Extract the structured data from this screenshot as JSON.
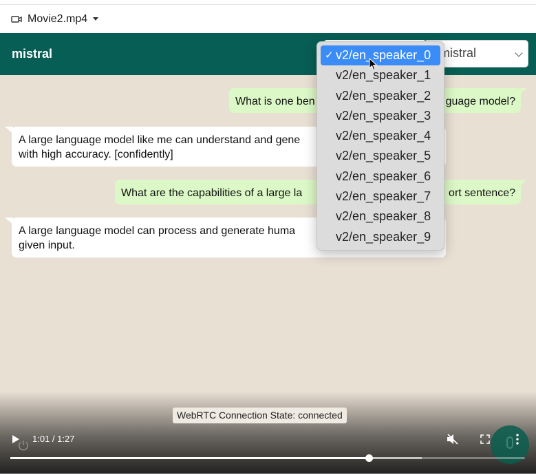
{
  "file": {
    "name": "Movie2.mp4",
    "icon": "video-camera-icon"
  },
  "header": {
    "title": "mistral",
    "model_select_value": "mistral",
    "voice_select_value": "v2/en_speaker_0"
  },
  "messages": [
    {
      "role": "user",
      "text_left": "What is one ben",
      "text_right": "guage model?"
    },
    {
      "role": "bot",
      "line1": "A large language model like me can understand and gene",
      "line2": "with high accuracy. [confidently]"
    },
    {
      "role": "user",
      "text_left": "What are the capabilities of a large la",
      "text_right": "ort sentence?"
    },
    {
      "role": "bot",
      "line1": "A large language model can process and generate huma",
      "line2": "given input."
    }
  ],
  "dropdown": {
    "selected": "v2/en_speaker_0",
    "check": "✓",
    "options": [
      "v2/en_speaker_0",
      "v2/en_speaker_1",
      "v2/en_speaker_2",
      "v2/en_speaker_3",
      "v2/en_speaker_4",
      "v2/en_speaker_5",
      "v2/en_speaker_6",
      "v2/en_speaker_7",
      "v2/en_speaker_8",
      "v2/en_speaker_9"
    ]
  },
  "status": {
    "webrtc": "WebRTC Connection State: connected"
  },
  "player": {
    "time": "1:01 / 1:27",
    "progress": 0.696,
    "buffered": 0.8
  },
  "colors": {
    "header": "#075e54",
    "user_bubble": "#dcf8c6",
    "bot_bubble": "#ffffff",
    "chat_bg": "#e9e0d4",
    "selected_option": "#3b8cf6"
  }
}
